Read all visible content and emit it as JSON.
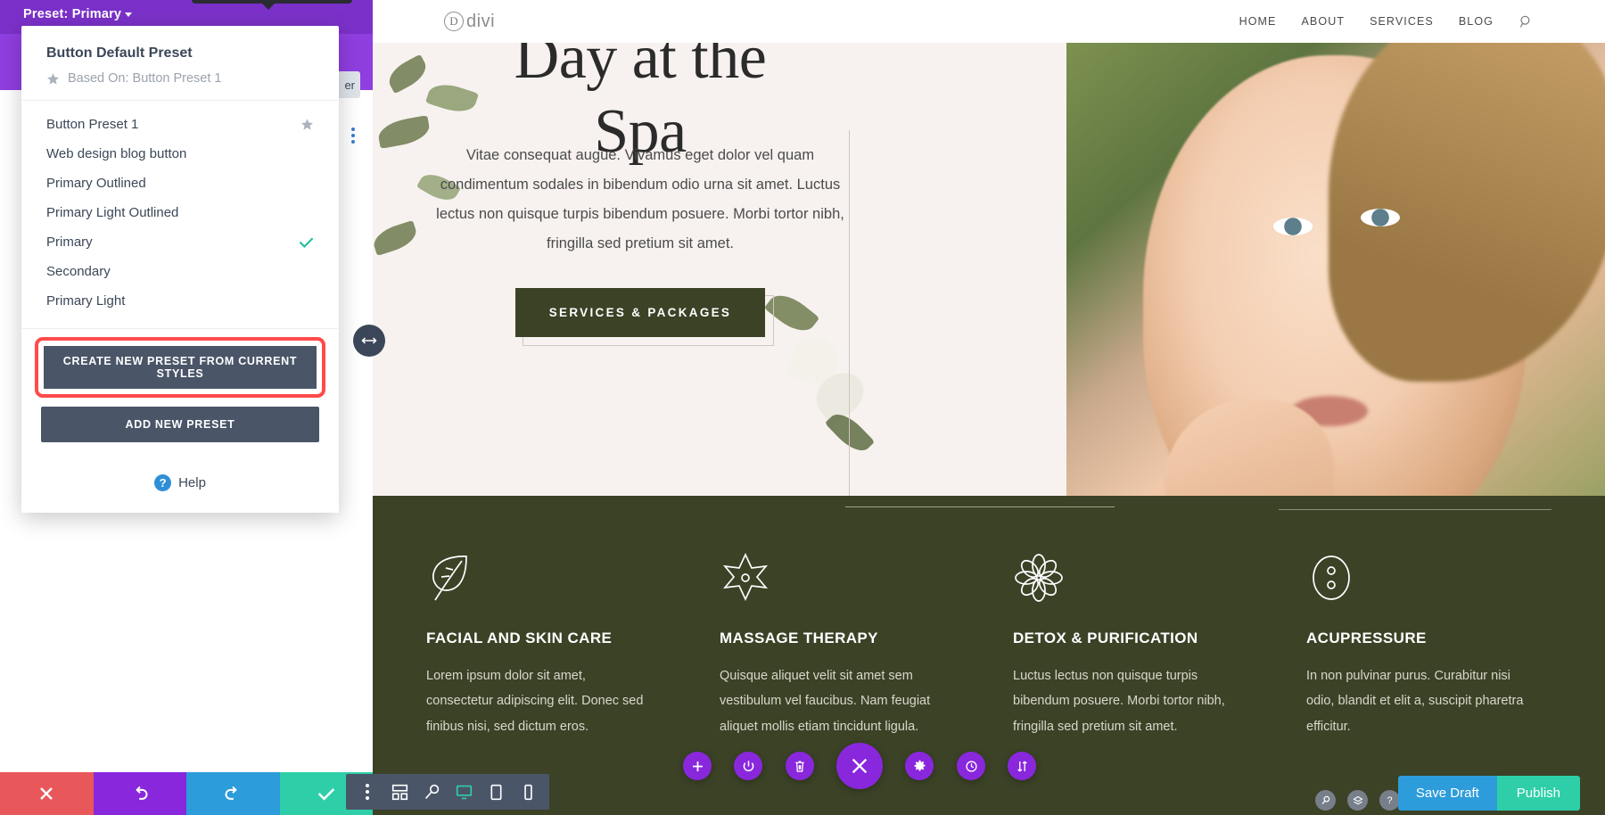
{
  "builder": {
    "preset_label": "Preset: Primary",
    "hidden_field_text": "er",
    "dropdown": {
      "title": "Button Default Preset",
      "based_on": "Based On: Button Preset 1",
      "items": [
        {
          "label": "Button Preset 1",
          "starred": true,
          "selected": false
        },
        {
          "label": "Web design blog button",
          "starred": false,
          "selected": false
        },
        {
          "label": "Primary Outlined",
          "starred": false,
          "selected": false
        },
        {
          "label": "Primary Light Outlined",
          "starred": false,
          "selected": false
        },
        {
          "label": "Primary",
          "starred": false,
          "selected": true
        },
        {
          "label": "Secondary",
          "starred": false,
          "selected": false
        },
        {
          "label": "Primary Light",
          "starred": false,
          "selected": false
        }
      ],
      "create_preset_button": "CREATE NEW PRESET FROM CURRENT STYLES",
      "add_preset_button": "ADD NEW PRESET",
      "help_label": "Help",
      "highlight_color": "#ff4b4b"
    },
    "bottom_bar": [
      {
        "name": "discard",
        "glyph": "✕",
        "color": "#e8585b"
      },
      {
        "name": "undo",
        "glyph": "↺",
        "color": "#8927dd"
      },
      {
        "name": "redo",
        "glyph": "↻",
        "color": "#2d9cdb"
      },
      {
        "name": "save",
        "glyph": "✔",
        "color": "#2ecfa8"
      }
    ],
    "mini_toolbar": [
      {
        "name": "more-options-icon",
        "glyph": "⋮",
        "active": false
      },
      {
        "name": "wireframe-view-icon",
        "glyph": "⊞",
        "active": false
      },
      {
        "name": "zoom-view-icon",
        "glyph": "⚲",
        "active": false
      },
      {
        "name": "desktop-view-icon",
        "glyph": "▢",
        "active": true
      },
      {
        "name": "tablet-view-icon",
        "glyph": "▯",
        "active": false
      },
      {
        "name": "phone-view-icon",
        "glyph": "▯",
        "active": false
      }
    ],
    "fabs": [
      {
        "name": "add-module-icon",
        "glyph": "＋",
        "size": "small"
      },
      {
        "name": "toggle-power-icon",
        "glyph": "⏻",
        "size": "small"
      },
      {
        "name": "delete-icon",
        "glyph": "Ὕ1",
        "size": "small"
      },
      {
        "name": "close-builder-icon",
        "glyph": "✕",
        "size": "big"
      },
      {
        "name": "settings-gear-icon",
        "glyph": "⚙",
        "size": "small"
      },
      {
        "name": "history-clock-icon",
        "glyph": "◴",
        "size": "small"
      },
      {
        "name": "sort-arrows-icon",
        "glyph": "⇅",
        "size": "small"
      }
    ],
    "utility_icons": [
      {
        "name": "search-icon",
        "glyph": "⚲"
      },
      {
        "name": "layers-icon",
        "glyph": "⬦"
      },
      {
        "name": "help-icon",
        "glyph": "?"
      }
    ],
    "save_draft_label": "Save Draft",
    "publish_label": "Publish"
  },
  "site": {
    "logo_mark": "D",
    "logo_text": "divi",
    "nav": [
      {
        "label": "HOME"
      },
      {
        "label": "ABOUT"
      },
      {
        "label": "SERVICES"
      },
      {
        "label": "BLOG"
      }
    ],
    "search_icon_name": "search-icon",
    "hero": {
      "title_line1": "Day at the",
      "title_line2": "Spa",
      "body": "Vitae consequat augue. Vivamus eget dolor vel quam condimentum sodales in bibendum odio urna sit amet. Luctus lectus non quisque turpis bibendum posuere. Morbi tortor nibh, fringilla sed pretium sit amet.",
      "cta_label": "SERVICES & PACKAGES",
      "cta_bg": "#3b4226"
    },
    "services": [
      {
        "icon": "leaf-icon",
        "title": "FACIAL AND SKIN CARE",
        "text": "Lorem ipsum dolor sit amet, consectetur adipiscing elit. Donec sed finibus nisi, sed dictum eros."
      },
      {
        "icon": "star-flower-icon",
        "title": "MASSAGE THERAPY",
        "text": "Quisque aliquet velit sit amet sem vestibulum vel faucibus. Nam feugiat aliquet mollis etiam tincidunt ligula."
      },
      {
        "icon": "flower-icon",
        "title": "DETOX & PURIFICATION",
        "text": "Luctus lectus non quisque turpis bibendum posuere. Morbi tortor nibh, fringilla sed pretium sit amet."
      },
      {
        "icon": "acupressure-icon",
        "title": "ACUPRESSURE",
        "text": "In non pulvinar purus. Curabitur nisi odio, blandit et elit a, suscipit pharetra efficitur."
      }
    ],
    "band_color": "#3b4226",
    "page_bg": "#f7f2ef"
  }
}
